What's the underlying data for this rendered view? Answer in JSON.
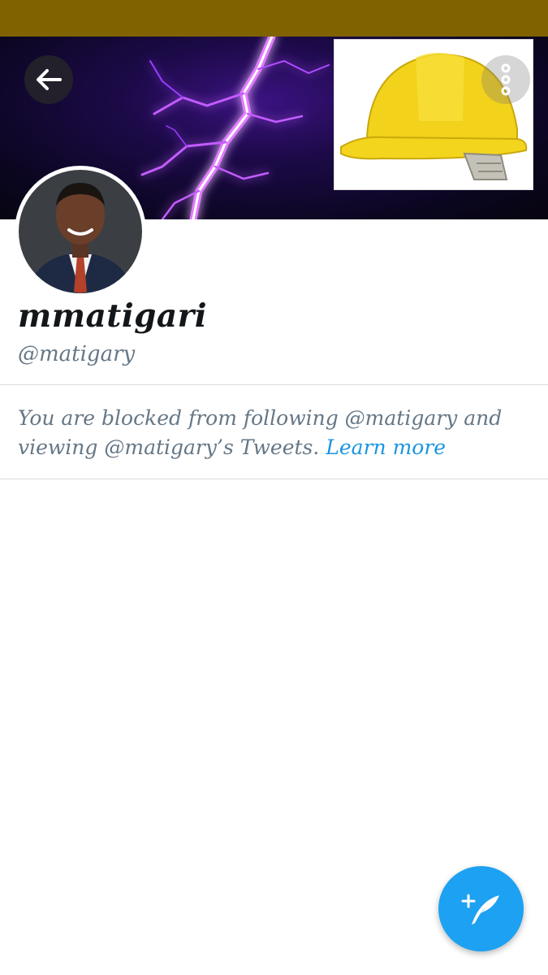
{
  "profile": {
    "display_name": "mmatigari",
    "handle": "@matigary"
  },
  "blocked_notice": {
    "text": "You are blocked from following @matigary and viewing @matigary’s Tweets.",
    "link": "Learn more"
  },
  "icons": {
    "back": "arrow-left-icon",
    "more": "more-vertical-icon",
    "compose": "compose-tweet-icon"
  },
  "colors": {
    "status_bar": "#806300",
    "accent": "#1da1f2",
    "link": "#1b95e0",
    "secondary_text": "#657786",
    "divider": "#d8dde2"
  }
}
